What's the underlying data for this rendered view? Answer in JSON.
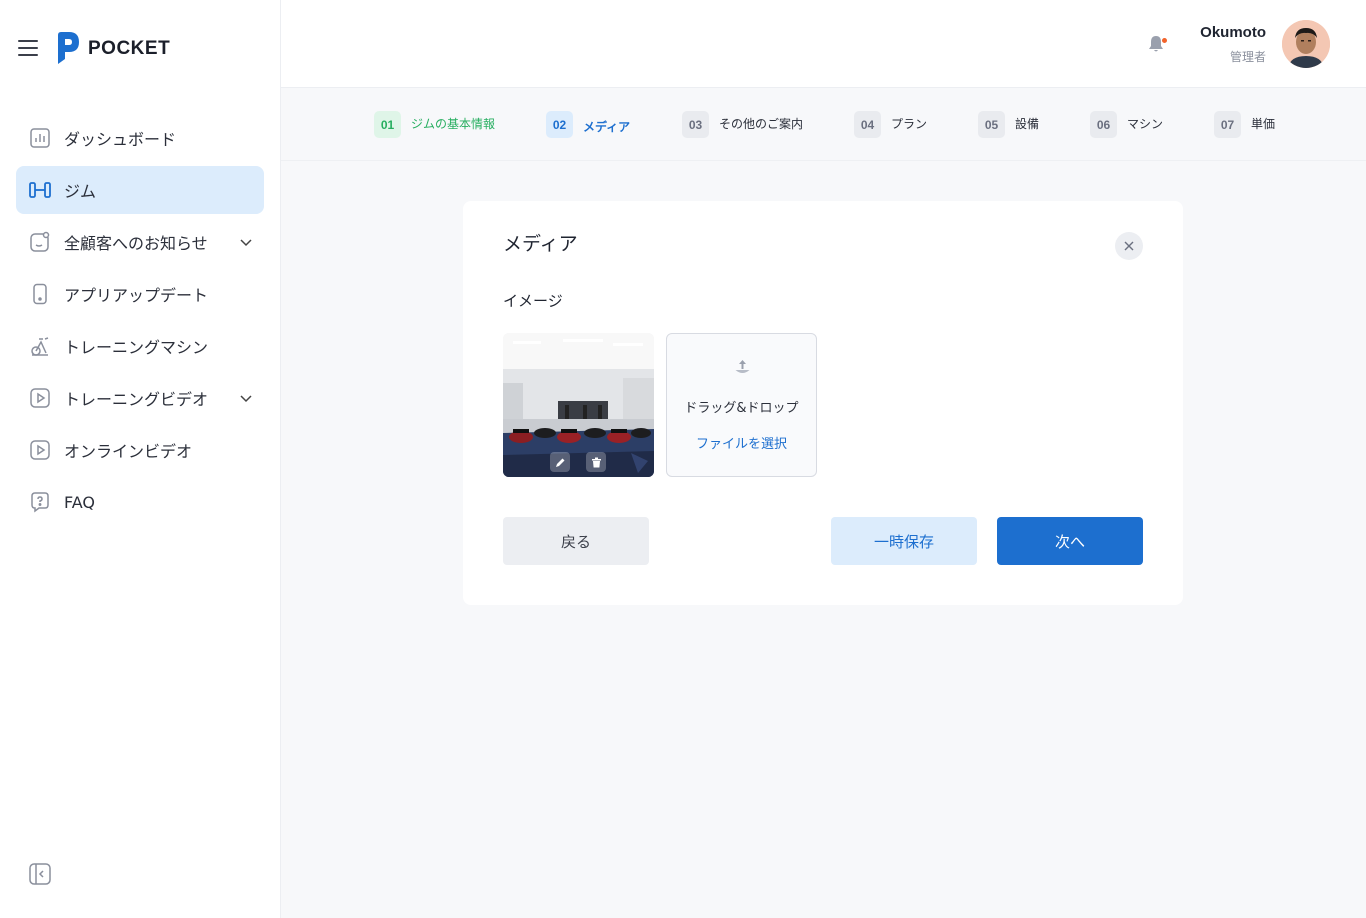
{
  "brand": {
    "name": "POCKET",
    "accent": "#1d6fcf"
  },
  "sidebar": {
    "items": [
      {
        "label": "ダッシュボード",
        "icon": "bar-chart-icon"
      },
      {
        "label": "ジム",
        "icon": "gym-icon",
        "active": true
      },
      {
        "label": "全顧客へのお知らせ",
        "icon": "notice-icon",
        "expandable": true
      },
      {
        "label": "アプリアップデート",
        "icon": "phone-icon"
      },
      {
        "label": "トレーニングマシン",
        "icon": "exercise-bike-icon"
      },
      {
        "label": "トレーニングビデオ",
        "icon": "video-play-icon",
        "expandable": true
      },
      {
        "label": "オンラインビデオ",
        "icon": "video-play-icon"
      },
      {
        "label": "FAQ",
        "icon": "question-bubble-icon"
      }
    ]
  },
  "header": {
    "user_name": "Okumoto",
    "user_role": "管理者",
    "notification_dot_color": "#f2632b"
  },
  "stepper": {
    "steps": [
      {
        "num": "01",
        "label": "ジムの基本情報",
        "state": "done"
      },
      {
        "num": "02",
        "label": "メディア",
        "state": "current"
      },
      {
        "num": "03",
        "label": "その他のご案内",
        "state": "pending"
      },
      {
        "num": "04",
        "label": "プラン",
        "state": "pending"
      },
      {
        "num": "05",
        "label": "設備",
        "state": "pending"
      },
      {
        "num": "06",
        "label": "マシン",
        "state": "pending"
      },
      {
        "num": "07",
        "label": "単価",
        "state": "pending"
      }
    ]
  },
  "card": {
    "title": "メディア",
    "section_label": "イメージ",
    "dropzone": {
      "text": "ドラッグ&ドロップ",
      "pick_label": "ファイルを選択"
    },
    "buttons": {
      "back": "戻る",
      "save": "一時保存",
      "next": "次へ"
    }
  }
}
